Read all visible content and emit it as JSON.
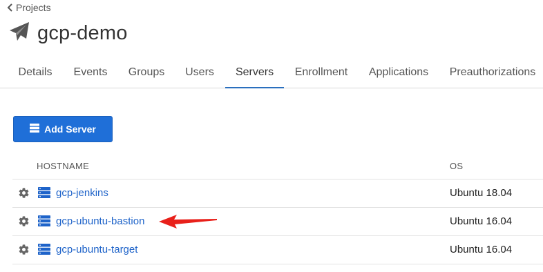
{
  "breadcrumb": {
    "label": "Projects"
  },
  "project": {
    "title": "gcp-demo"
  },
  "tabs": [
    {
      "label": "Details"
    },
    {
      "label": "Events"
    },
    {
      "label": "Groups"
    },
    {
      "label": "Users"
    },
    {
      "label": "Servers",
      "active": true
    },
    {
      "label": "Enrollment"
    },
    {
      "label": "Applications"
    },
    {
      "label": "Preauthorizations"
    }
  ],
  "actions": {
    "add_server_label": "Add Server"
  },
  "table": {
    "headers": {
      "hostname": "HOSTNAME",
      "os": "OS"
    },
    "rows": [
      {
        "hostname": "gcp-jenkins",
        "os": "Ubuntu 18.04"
      },
      {
        "hostname": "gcp-ubuntu-bastion",
        "os": "Ubuntu 16.04"
      },
      {
        "hostname": "gcp-ubuntu-target",
        "os": "Ubuntu 16.04"
      }
    ]
  },
  "colors": {
    "accent": "#1f6fd8",
    "link": "#1e63c9",
    "annotation_arrow": "#e8201a"
  }
}
